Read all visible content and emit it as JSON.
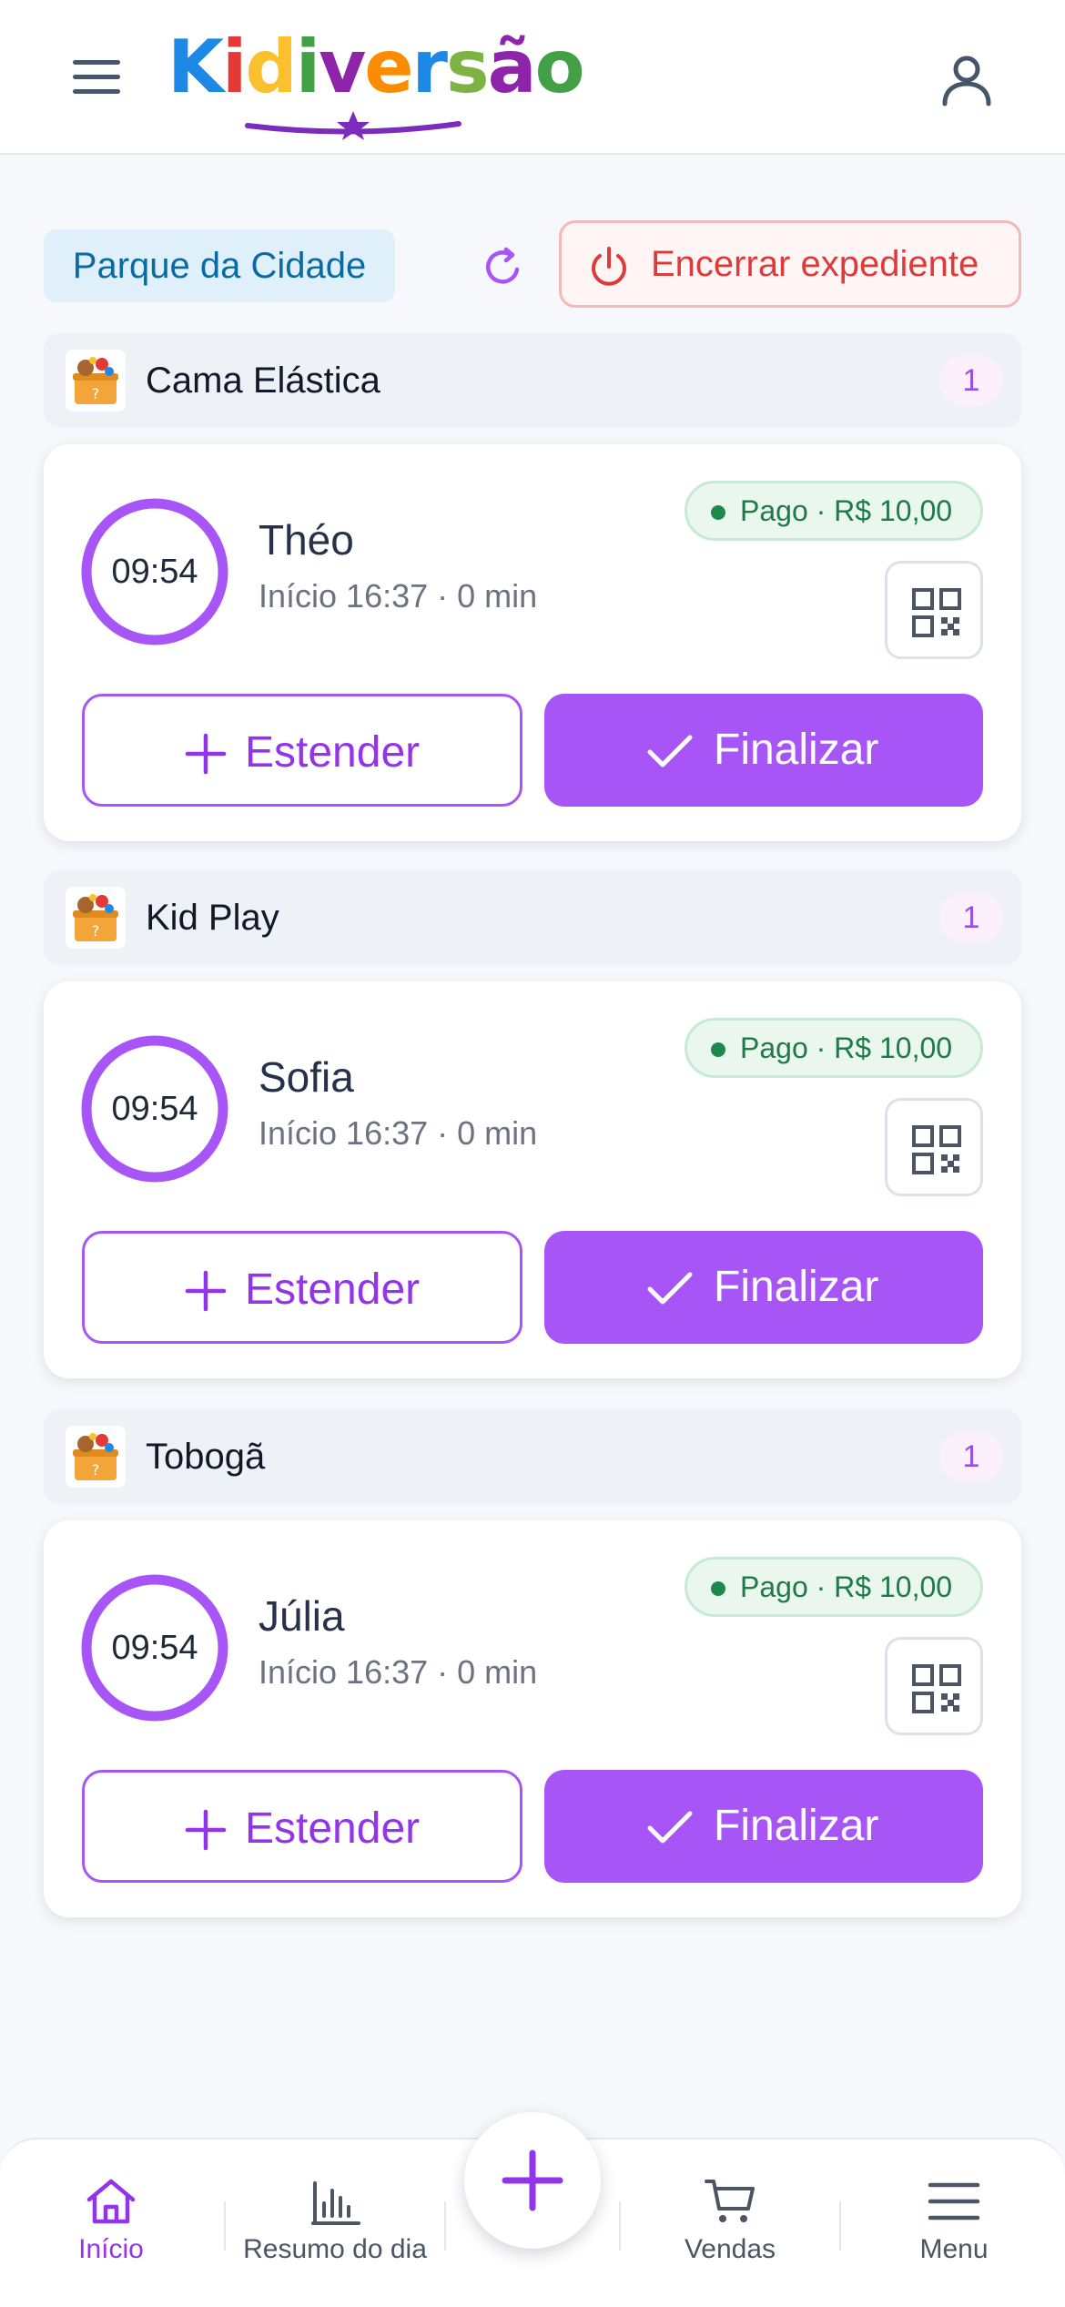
{
  "header": {
    "menu_icon": "hamburger-icon",
    "logo_text": "Kidiversão",
    "logo_colors": [
      "#1e88e5",
      "#e53935",
      "#fbc02d",
      "#43a047",
      "#8e24aa",
      "#fb8c00",
      "#1e88e5",
      "#7cb342",
      "#8e24aa",
      "#43a047"
    ],
    "user_icon": "user-icon"
  },
  "controls": {
    "location": "Parque da Cidade",
    "refresh_icon": "refresh-icon",
    "end_shift_label": "Encerrar expediente",
    "end_shift_icon": "power-icon"
  },
  "sections": [
    {
      "title": "Cama Elástica",
      "count": "1",
      "session": {
        "timer": "09:54",
        "name": "Théo",
        "start": "Início 16:37 · 0 min",
        "payment": "Pago · R$ 10,00"
      }
    },
    {
      "title": "Kid Play",
      "count": "1",
      "session": {
        "timer": "09:54",
        "name": "Sofia",
        "start": "Início 16:37 · 0 min",
        "payment": "Pago · R$ 10,00"
      }
    },
    {
      "title": "Tobogã",
      "count": "1",
      "session": {
        "timer": "09:54",
        "name": "Júlia",
        "start": "Início 16:37 · 0 min",
        "payment": "Pago · R$ 10,00"
      }
    }
  ],
  "actions": {
    "extend_label": "Estender",
    "finish_label": "Finalizar"
  },
  "bottom_nav": {
    "items": [
      {
        "label": "Início",
        "icon": "home-icon",
        "active": true
      },
      {
        "label": "Resumo do dia",
        "icon": "bar-chart-icon",
        "active": false
      },
      {
        "label": "Vendas",
        "icon": "cart-icon",
        "active": false
      },
      {
        "label": "Menu",
        "icon": "menu-icon",
        "active": false
      }
    ],
    "fab_icon": "plus-icon"
  },
  "colors": {
    "accent": "#a855f7",
    "danger": "#dc3b3b",
    "success": "#1d8a4d",
    "location": "#0b6aa2"
  }
}
